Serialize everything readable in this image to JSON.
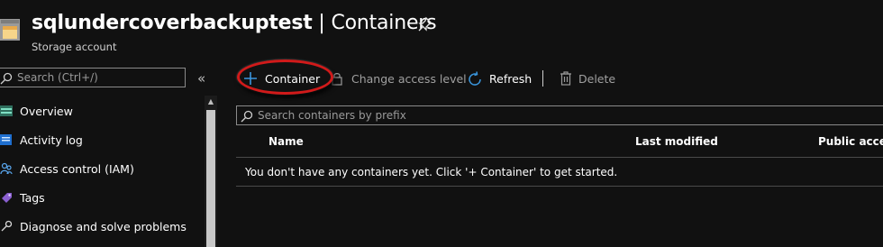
{
  "header": {
    "resource_name": "sqlundercoverbackuptest",
    "separator": " | ",
    "blade_title": "Containers",
    "subtitle": "Storage account",
    "resource_icon": "storage-account-icon",
    "pin_icon": "pin-icon"
  },
  "sidebar": {
    "search_placeholder": "Search (Ctrl+/)",
    "collapse_glyph": "«",
    "items": [
      {
        "label": "Overview",
        "icon": "overview-icon"
      },
      {
        "label": "Activity log",
        "icon": "activity-log-icon"
      },
      {
        "label": "Access control (IAM)",
        "icon": "iam-icon"
      },
      {
        "label": "Tags",
        "icon": "tag-icon"
      },
      {
        "label": "Diagnose and solve problems",
        "icon": "wrench-icon"
      }
    ]
  },
  "toolbar": {
    "add_container_label": "Container",
    "change_access_label": "Change access level",
    "refresh_label": "Refresh",
    "delete_label": "Delete"
  },
  "filter": {
    "placeholder": "Search containers by prefix"
  },
  "table": {
    "columns": [
      "Name",
      "Last modified",
      "Public acces"
    ],
    "empty_message": "You don't have any containers yet. Click '+ Container' to get started."
  },
  "colors": {
    "background": "#111111",
    "accent_blue": "#3a96dd",
    "highlight_red": "#d11a1a",
    "disabled_text": "#a0a0a0"
  }
}
